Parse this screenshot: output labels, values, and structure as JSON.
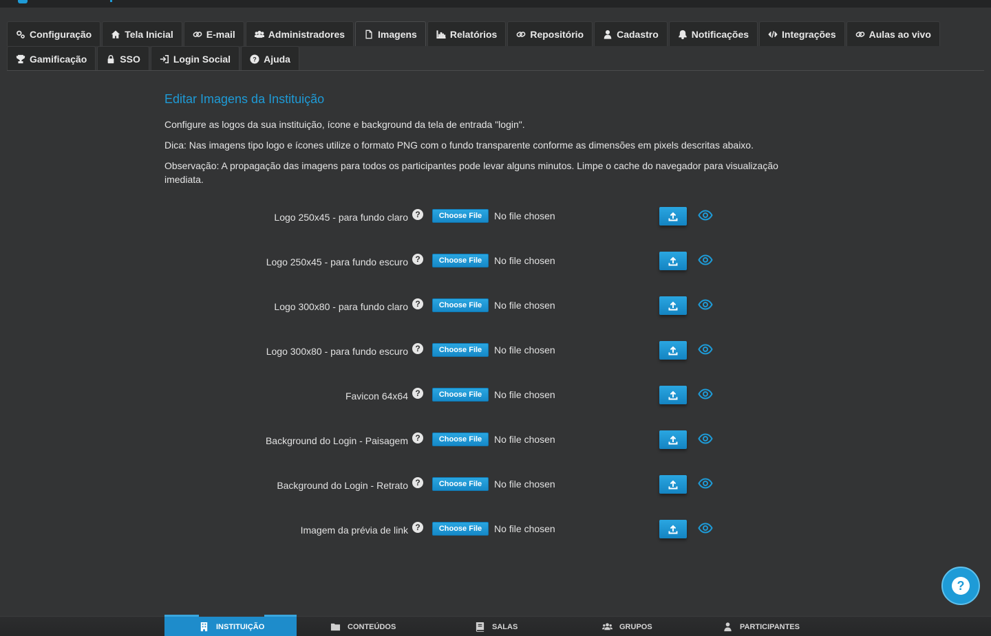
{
  "tabs": {
    "row1": [
      {
        "label": "Configuração",
        "icon": "gears-icon"
      },
      {
        "label": "Tela Inicial",
        "icon": "home-icon"
      },
      {
        "label": "E-mail",
        "icon": "link-icon"
      },
      {
        "label": "Administradores",
        "icon": "users-icon"
      },
      {
        "label": "Imagens",
        "icon": "file-icon",
        "active": true
      },
      {
        "label": "Relatórios",
        "icon": "bar-chart-icon"
      },
      {
        "label": "Repositório",
        "icon": "link-icon"
      },
      {
        "label": "Cadastro",
        "icon": "user-icon"
      },
      {
        "label": "Notificações",
        "icon": "bell-icon"
      },
      {
        "label": "Integrações",
        "icon": "code-icon"
      },
      {
        "label": "Aulas ao vivo",
        "icon": "link-icon"
      }
    ],
    "row2": [
      {
        "label": "Gamificação",
        "icon": "trophy-icon"
      },
      {
        "label": "SSO",
        "icon": "lock-icon"
      },
      {
        "label": "Login Social",
        "icon": "sign-in-icon"
      },
      {
        "label": "Ajuda",
        "icon": "question-circle-icon"
      }
    ]
  },
  "content": {
    "title": "Editar Imagens da Instituição",
    "paragraph1": "Configure as logos da sua instituição, ícone e background da tela de entrada \"login\".",
    "paragraph2": "Dica: Nas imagens tipo logo e ícones utilize o formato PNG com o fundo transparente conforme as dimensões em pixels descritas abaixo.",
    "paragraph3": "Observação: A propagação das imagens para todos os participantes pode levar alguns minutos. Limpe o cache do navegador para visualização imediata."
  },
  "upload_rows": [
    {
      "label": "Logo 250x45 - para fundo claro",
      "choose_label": "Choose File",
      "file_status": "No file chosen"
    },
    {
      "label": "Logo 250x45 - para fundo escuro",
      "choose_label": "Choose File",
      "file_status": "No file chosen"
    },
    {
      "label": "Logo 300x80 - para fundo claro",
      "choose_label": "Choose File",
      "file_status": "No file chosen"
    },
    {
      "label": "Logo 300x80 - para fundo escuro",
      "choose_label": "Choose File",
      "file_status": "No file chosen"
    },
    {
      "label": "Favicon 64x64",
      "choose_label": "Choose File",
      "file_status": "No file chosen"
    },
    {
      "label": "Background do Login - Paisagem",
      "choose_label": "Choose File",
      "file_status": "No file chosen"
    },
    {
      "label": "Background do Login - Retrato",
      "choose_label": "Choose File",
      "file_status": "No file chosen"
    },
    {
      "label": "Imagem da prévia de link",
      "choose_label": "Choose File",
      "file_status": "No file chosen"
    }
  ],
  "help_glyph": "?",
  "bottom_nav": [
    {
      "label": "INSTITUIÇÃO",
      "icon": "building-icon",
      "active": true
    },
    {
      "label": "CONTEÚDOS",
      "icon": "folder-icon"
    },
    {
      "label": "SALAS",
      "icon": "book-icon"
    },
    {
      "label": "GRUPOS",
      "icon": "users-icon"
    },
    {
      "label": "PARTICIPANTES",
      "icon": "user-icon"
    }
  ],
  "colors": {
    "accent": "#1e9bd7",
    "background": "#333435",
    "tab_bg": "#282929"
  }
}
